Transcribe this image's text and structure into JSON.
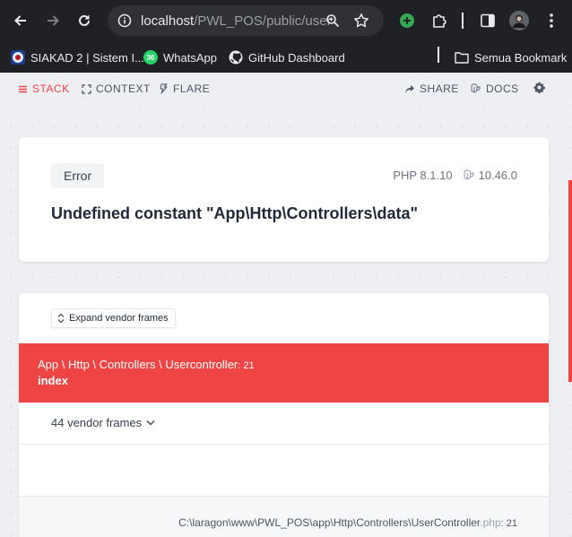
{
  "browser": {
    "url_host": "localhost",
    "url_path": "/PWL_POS/public/user",
    "bookmarks": [
      {
        "label": "SIAKAD 2 | Sistem I...",
        "icon": "siakad-icon"
      },
      {
        "label": "WhatsApp",
        "icon": "whatsapp-icon",
        "badge": "36"
      },
      {
        "label": "GitHub Dashboard",
        "icon": "github-icon"
      }
    ],
    "all_bookmarks_label": "Semua Bookmark"
  },
  "ignition_nav": {
    "stack": "STACK",
    "context": "CONTEXT",
    "flare": "FLARE",
    "share": "SHARE",
    "docs": "DOCS"
  },
  "error": {
    "badge": "Error",
    "php_version": "PHP 8.1.10",
    "laravel_version": "10.46.0",
    "message": "Undefined constant \"App\\Http\\Controllers\\data\""
  },
  "stack": {
    "expand_label": "Expand vendor frames",
    "active_frame": {
      "class_path": "App \\ Http \\ Controllers \\ Usercontroller",
      "line": ": 21",
      "method": "index"
    },
    "vendor_frames_label": "44 vendor frames",
    "file_path": "C:\\laragon\\www\\PWL_POS\\app\\Http\\Controllers\\UserController",
    "file_ext": ".php",
    "file_line": ": 21"
  },
  "colors": {
    "accent": "#ef4444",
    "chrome": "#202124"
  }
}
